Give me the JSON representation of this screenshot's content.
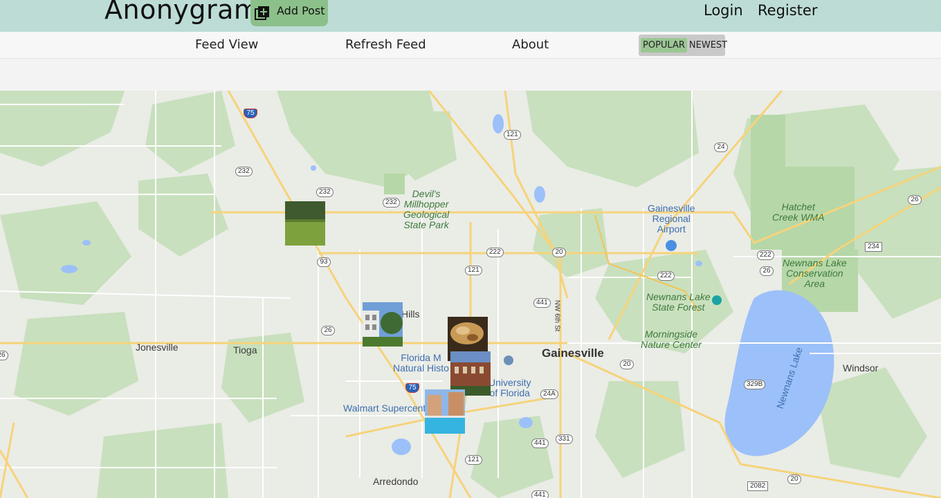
{
  "header": {
    "brand": "Anonygram",
    "add_post_label": "Add Post",
    "login_label": "Login",
    "register_label": "Register",
    "accent": "#bddcd6",
    "button_color": "#8cc08a"
  },
  "nav": {
    "feed_view": "Feed View",
    "refresh_feed": "Refresh Feed",
    "about": "About",
    "sort": {
      "popular": "POPULAR",
      "newest": "NEWEST",
      "selected": "POPULAR"
    }
  },
  "map": {
    "places": {
      "devils_millhopper": "Devil's\nMillhopper\nGeological\nState Park",
      "gnv_airport": "Gainesville\nRegional\nAirport",
      "hatchet_creek": "Hatchet\nCreek WMA",
      "newnans_conservation": "Newnans Lake\nConservation\nArea",
      "newnans_forest": "Newnans Lake\nState Forest",
      "morningside": "Morningside\nNature Center",
      "gainesville": "Gainesville",
      "jonesville": "Jonesville",
      "tioga": "Tioga",
      "windsor": "Windsor",
      "newnans_lake": "Newnans Lake",
      "florida_museum": "Florida M\nNatural Histo",
      "uf": "University\nof Florida",
      "walmart": "Walmart Supercente",
      "arredondo": "Arredondo",
      "hills": "Hills",
      "nw6th": "NW 6th St"
    },
    "shields": [
      "75",
      "121",
      "24",
      "232",
      "232",
      "232",
      "26",
      "222",
      "20",
      "234",
      "222",
      "93",
      "121",
      "222",
      "26",
      "441",
      "26",
      "20",
      "329B",
      "24A",
      "75",
      "331",
      "441",
      "121",
      "20",
      "2082",
      "441",
      "26"
    ]
  },
  "posts": [
    "post-thumbnail-field",
    "post-thumbnail-building",
    "post-thumbnail-food",
    "post-thumbnail-hall",
    "post-thumbnail-pool"
  ]
}
